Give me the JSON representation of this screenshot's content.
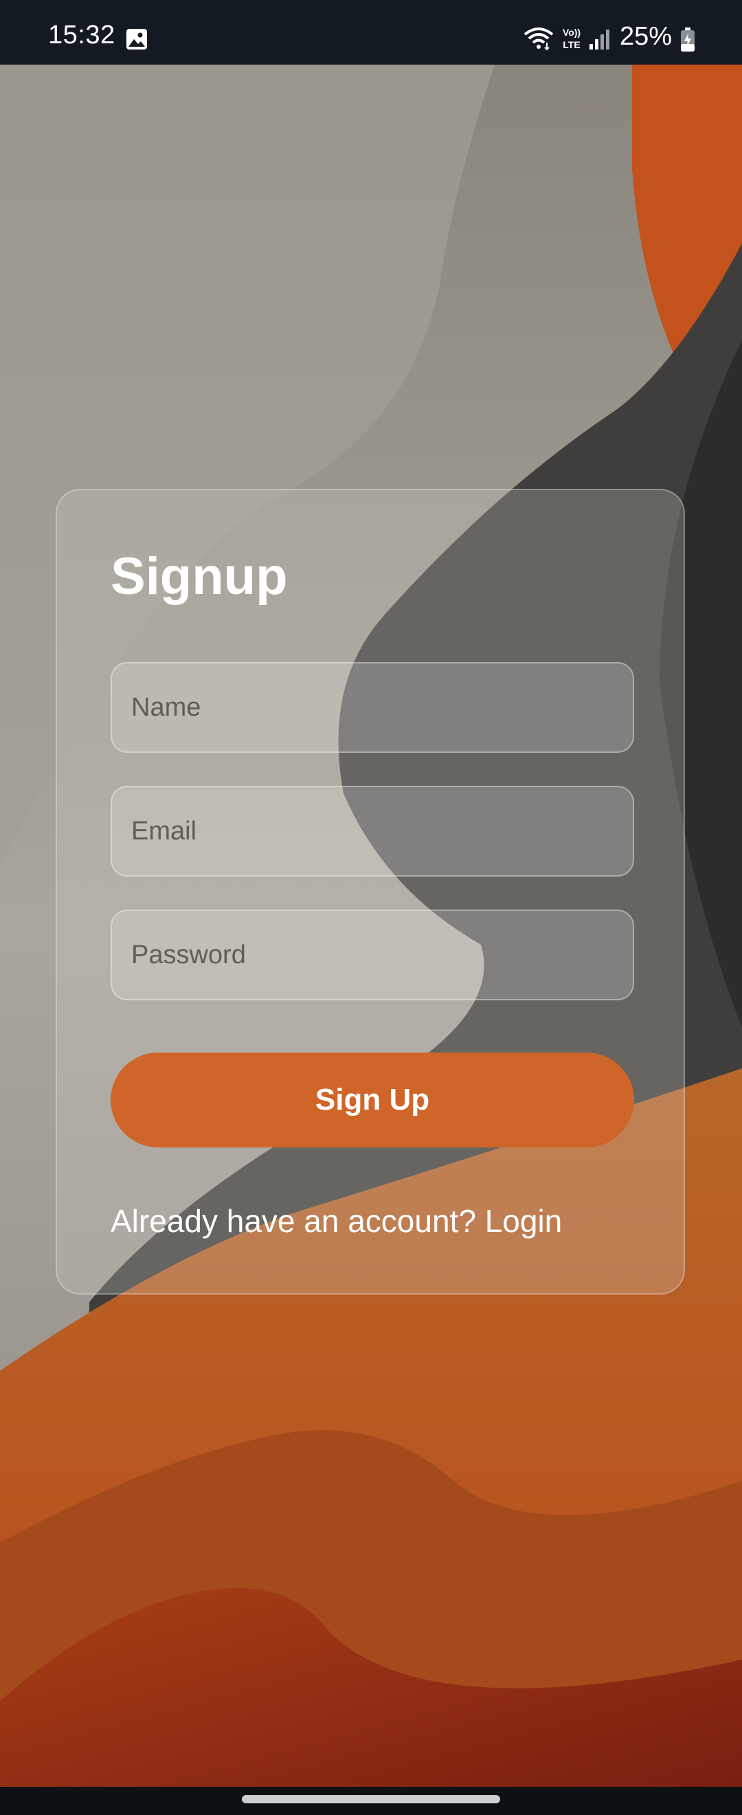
{
  "status_bar": {
    "time": "15:32",
    "battery_percent": "25%",
    "network_label": "VoLTE",
    "icons": [
      "gallery-icon",
      "wifi-icon",
      "volte-icon",
      "signal-icon",
      "battery-icon"
    ]
  },
  "signup": {
    "title": "Signup",
    "name_placeholder": "Name",
    "email_placeholder": "Email",
    "password_placeholder": "Password",
    "button_label": "Sign Up",
    "login_prompt": "Already have an account?",
    "login_link": "Login"
  },
  "colors": {
    "accent": "#d0652a",
    "status_bar_bg": "#141a22",
    "background_beige": "#a8a49c",
    "background_orange": "#c8551c",
    "background_dark": "#3a3a3a"
  }
}
